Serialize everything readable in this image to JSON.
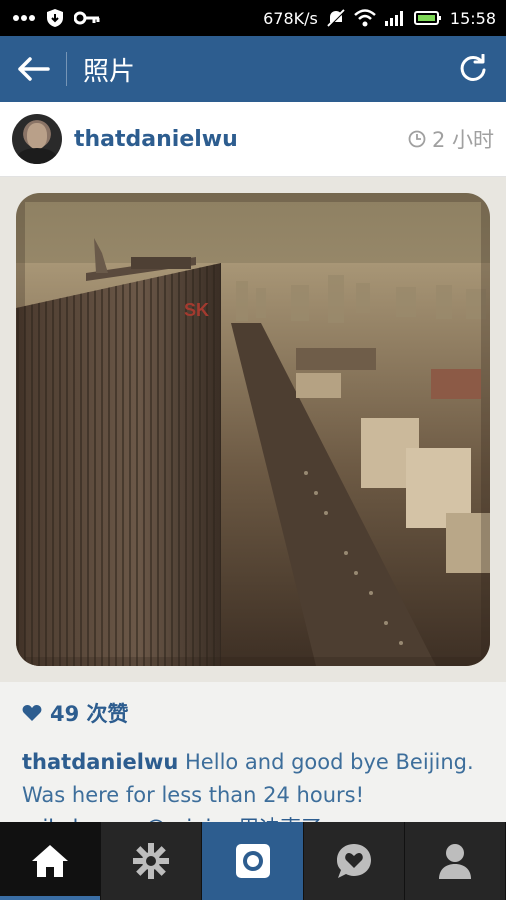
{
  "status_bar": {
    "network_speed": "678K/s",
    "time": "15:58",
    "icons": [
      "notification-dots-icon",
      "shield-icon",
      "key-icon",
      "mute-icon",
      "wifi-icon",
      "signal-icon",
      "battery-icon"
    ]
  },
  "app_bar": {
    "title": "照片",
    "back_icon": "arrow-left-icon",
    "refresh_icon": "refresh-icon"
  },
  "post": {
    "username": "thatdanielwu",
    "time_ago": "2 小时",
    "likes_text": "49 次赞",
    "caption_user": "thatdanielwu",
    "caption_text": " Hello and good bye Beijing. Was here for less than 24 hours!",
    "comment_peek": "mikehuang @ ninj... 用迪声了"
  },
  "tab_bar": {
    "tabs": [
      "home-icon",
      "explore-icon",
      "camera-icon",
      "activity-icon",
      "profile-icon"
    ],
    "active_tab": "home-icon"
  },
  "colors": {
    "brand": "#2d5d8f",
    "link": "#2d5d8f",
    "caption_text": "#3d6e9b"
  }
}
